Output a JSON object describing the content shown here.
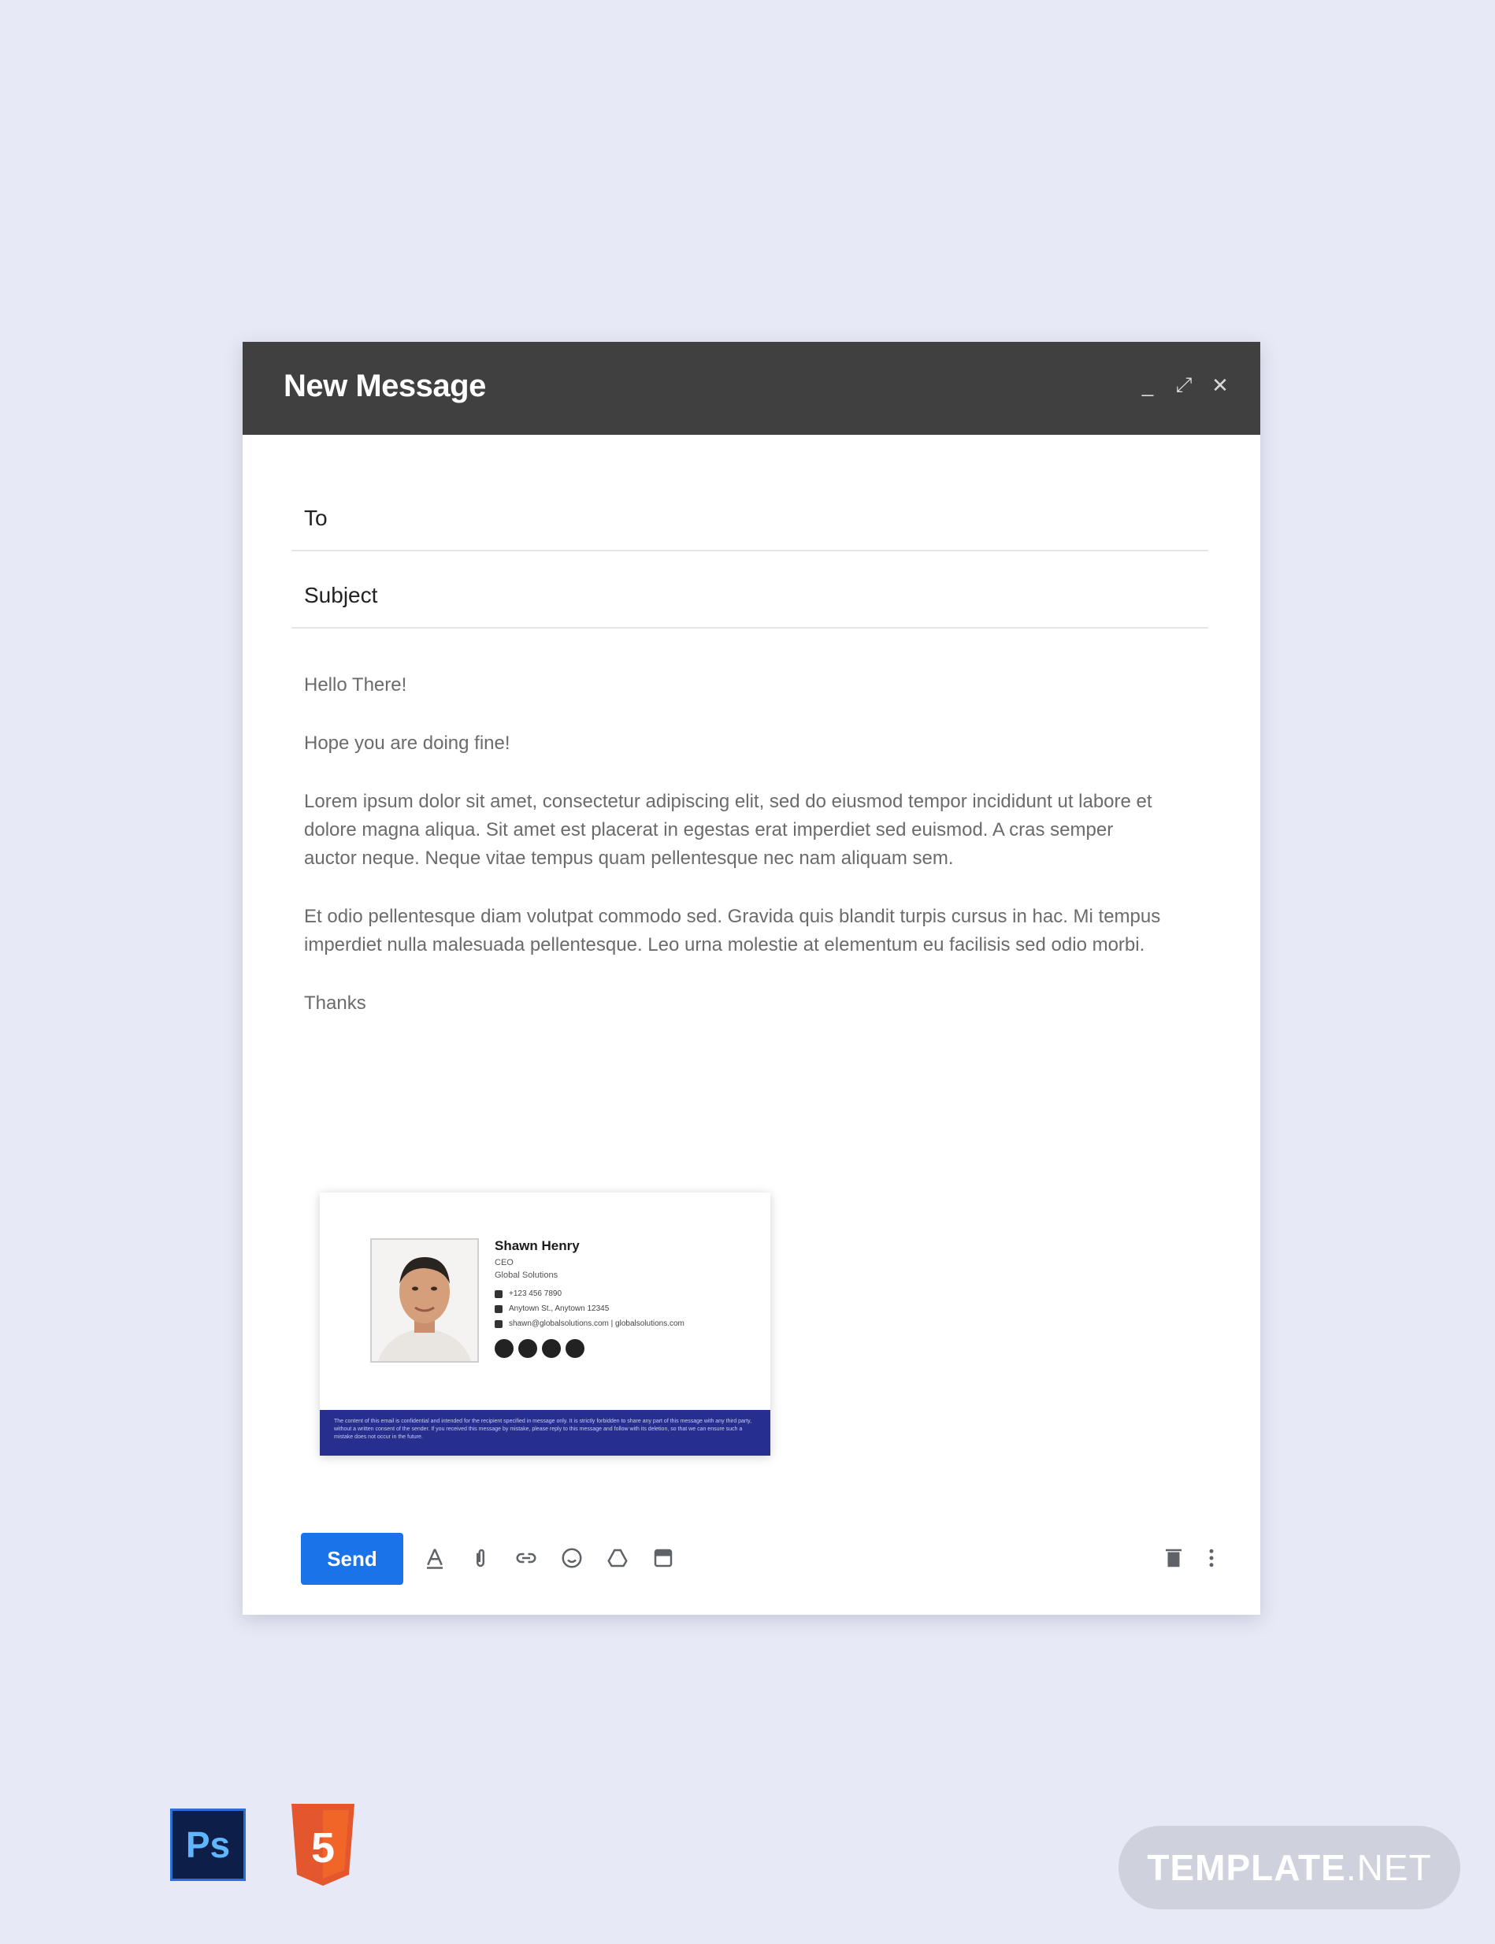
{
  "window": {
    "title": "New Message",
    "minimize_label": "_",
    "maximize_label": "⤢",
    "close_label": "✕"
  },
  "fields": {
    "to_label": "To",
    "to_value": "",
    "subject_label": "Subject",
    "subject_value": ""
  },
  "body": {
    "greeting": "Hello There!",
    "line2": "Hope you are doing fine!",
    "para1": "Lorem ipsum dolor sit amet, consectetur adipiscing elit, sed do eiusmod tempor incididunt ut labore et dolore magna aliqua. Sit amet est placerat in egestas erat imperdiet sed euismod. A cras semper auctor neque. Neque vitae tempus quam pellentesque nec nam aliquam sem.",
    "para2": " Et odio pellentesque diam volutpat commodo sed. Gravida quis blandit turpis cursus in hac. Mi tempus imperdiet nulla malesuada pellentesque. Leo urna molestie at elementum eu facilisis sed odio morbi.",
    "closing": "Thanks"
  },
  "signature": {
    "name": "Shawn Henry",
    "title": "CEO",
    "company": "Global Solutions",
    "phone": "+123 456 7890",
    "address": "Anytown St., Anytown 12345",
    "contact": "shawn@globalsolutions.com | globalsolutions.com",
    "footer_text": "The content of this email is confidential and intended for the recipient specified in message only. It is strictly forbidden to share any part of this message with any third party, without a written consent of the sender. If you received this message by mistake, please reply to this message and follow with its deletion, so that we can ensure such a mistake does not occur in the future."
  },
  "toolbar": {
    "send_label": "Send"
  },
  "badges": {
    "ps_label": "Ps",
    "html_label": "5",
    "template_label_bold": "TEMPLATE",
    "template_label_thin": ".NET"
  },
  "colors": {
    "background": "#e7e9f6",
    "titlebar": "#404040",
    "send_button": "#1a73e8",
    "signature_footer": "#262e8e",
    "html5_orange": "#e4572e"
  },
  "icons": [
    "minimize-icon",
    "maximize-icon",
    "close-icon",
    "text-format-icon",
    "attach-icon",
    "link-icon",
    "emoji-icon",
    "drive-icon",
    "photo-icon",
    "trash-icon",
    "more-options-icon",
    "phone-icon",
    "location-icon",
    "email-icon"
  ]
}
